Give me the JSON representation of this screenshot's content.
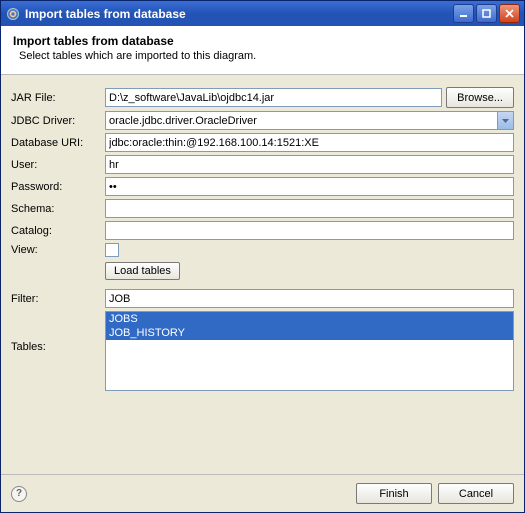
{
  "window": {
    "title": "Import tables from database"
  },
  "title_buttons": {
    "minimize": "minimize",
    "maximize": "maximize",
    "close": "close"
  },
  "header": {
    "title": "Import tables from database",
    "subtitle": "Select tables which are imported to this diagram."
  },
  "labels": {
    "jar_file": "JAR File:",
    "jdbc_driver": "JDBC Driver:",
    "database_uri": "Database URI:",
    "user": "User:",
    "password": "Password:",
    "schema": "Schema:",
    "catalog": "Catalog:",
    "view": "View:",
    "filter": "Filter:",
    "tables": "Tables:"
  },
  "buttons": {
    "browse": "Browse...",
    "load_tables": "Load tables",
    "finish": "Finish",
    "cancel": "Cancel"
  },
  "values": {
    "jar_file": "D:\\z_software\\JavaLib\\ojdbc14.jar",
    "jdbc_driver": "oracle.jdbc.driver.OracleDriver",
    "database_uri": "jdbc:oracle:thin:@192.168.100.14:1521:XE",
    "user": "hr",
    "password": "••",
    "schema": "",
    "catalog": "",
    "view_checked": false,
    "filter": "JOB"
  },
  "tables_list": [
    "JOBS",
    "JOB_HISTORY"
  ]
}
